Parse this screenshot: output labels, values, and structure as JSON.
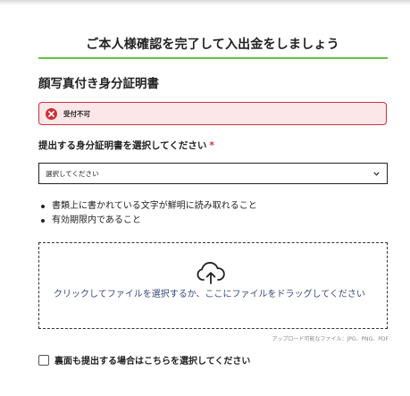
{
  "page": {
    "title": "ご本人様確認を完了して入出金をしましょう",
    "section_title": "顔写真付き身分証明書"
  },
  "status": {
    "label": "受付不可",
    "icon": "close-circle-icon",
    "color": "#c8323c"
  },
  "document_select": {
    "label": "提出する身分証明書を選択してください",
    "required_mark": "*",
    "selected_value": "選択してください",
    "icon": "chevron-down-icon"
  },
  "requirements": [
    "書類上に書かれている文字が鮮明に読み取れること",
    "有効期限内であること"
  ],
  "upload": {
    "icon": "cloud-upload-icon",
    "instruction": "クリックしてファイルを選択するか、ここにファイルをドラッグしてください",
    "allowed_types": "アップロード可能なファイル：JPG、PNG、PDF"
  },
  "back_side_option": {
    "label": "裏面も提出する場合はこちらを選択してください",
    "checked": false
  },
  "colors": {
    "accent_green": "#6cbf47",
    "error_red": "#c8323c",
    "alert_background": "#fbe6e8",
    "link_text": "#3a4a7a"
  }
}
